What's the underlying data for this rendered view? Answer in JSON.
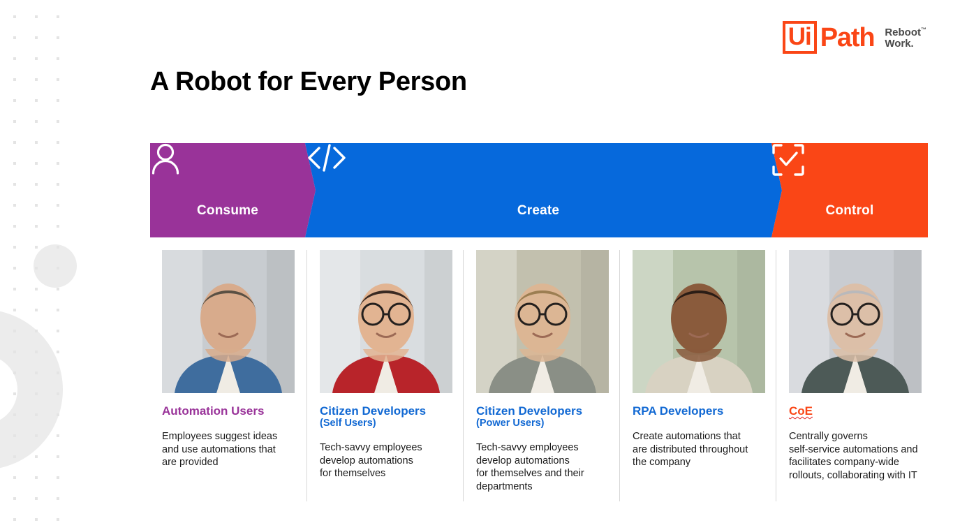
{
  "brand": {
    "logo_ui": "Ui",
    "logo_path": "Path",
    "tagline_line1": "Reboot",
    "tagline_line2": "Work.",
    "tagline_tm": "™",
    "orange": "#fa4616",
    "purple": "#993399",
    "blue": "#0669dc"
  },
  "header": {
    "title": "A Robot for Every Person"
  },
  "banner": {
    "segments": [
      {
        "id": "consume",
        "label": "Consume",
        "icon": "person-icon",
        "color": "#993399"
      },
      {
        "id": "create",
        "label": "Create",
        "icon": "code-brackets-icon",
        "color": "#0669dc"
      },
      {
        "id": "control",
        "label": "Control",
        "icon": "scan-check-icon",
        "color": "#fa4616"
      }
    ]
  },
  "personas": [
    {
      "photo_name": "photo-automation-users",
      "heading": "Automation Users",
      "subheading": "",
      "heading_color": "purple",
      "spellcheck_flag": false,
      "body": "Employees suggest ideas\nand use automations that\nare provided"
    },
    {
      "photo_name": "photo-citizen-developers-self",
      "heading": "Citizen Developers",
      "subheading": "(Self Users)",
      "heading_color": "blue",
      "spellcheck_flag": false,
      "body": "Tech-savvy employees\ndevelop automations\nfor themselves"
    },
    {
      "photo_name": "photo-citizen-developers-power",
      "heading": "Citizen Developers",
      "subheading": "(Power Users)",
      "heading_color": "blue",
      "spellcheck_flag": false,
      "body": "Tech-savvy employees\ndevelop automations\nfor themselves and their\ndepartments"
    },
    {
      "photo_name": "photo-rpa-developers",
      "heading": "RPA Developers",
      "subheading": "",
      "heading_color": "blue",
      "spellcheck_flag": false,
      "body": "Create automations that\nare distributed throughout\nthe company"
    },
    {
      "photo_name": "photo-coe",
      "heading": "CoE",
      "subheading": "",
      "heading_color": "orange",
      "spellcheck_flag": true,
      "body": "Centrally governs\nself-service automations and\nfacilitates company-wide\nrollouts, collaborating with IT"
    }
  ],
  "decor": {
    "dot_color": "#e4e4e4",
    "shape_color": "#ececec"
  }
}
